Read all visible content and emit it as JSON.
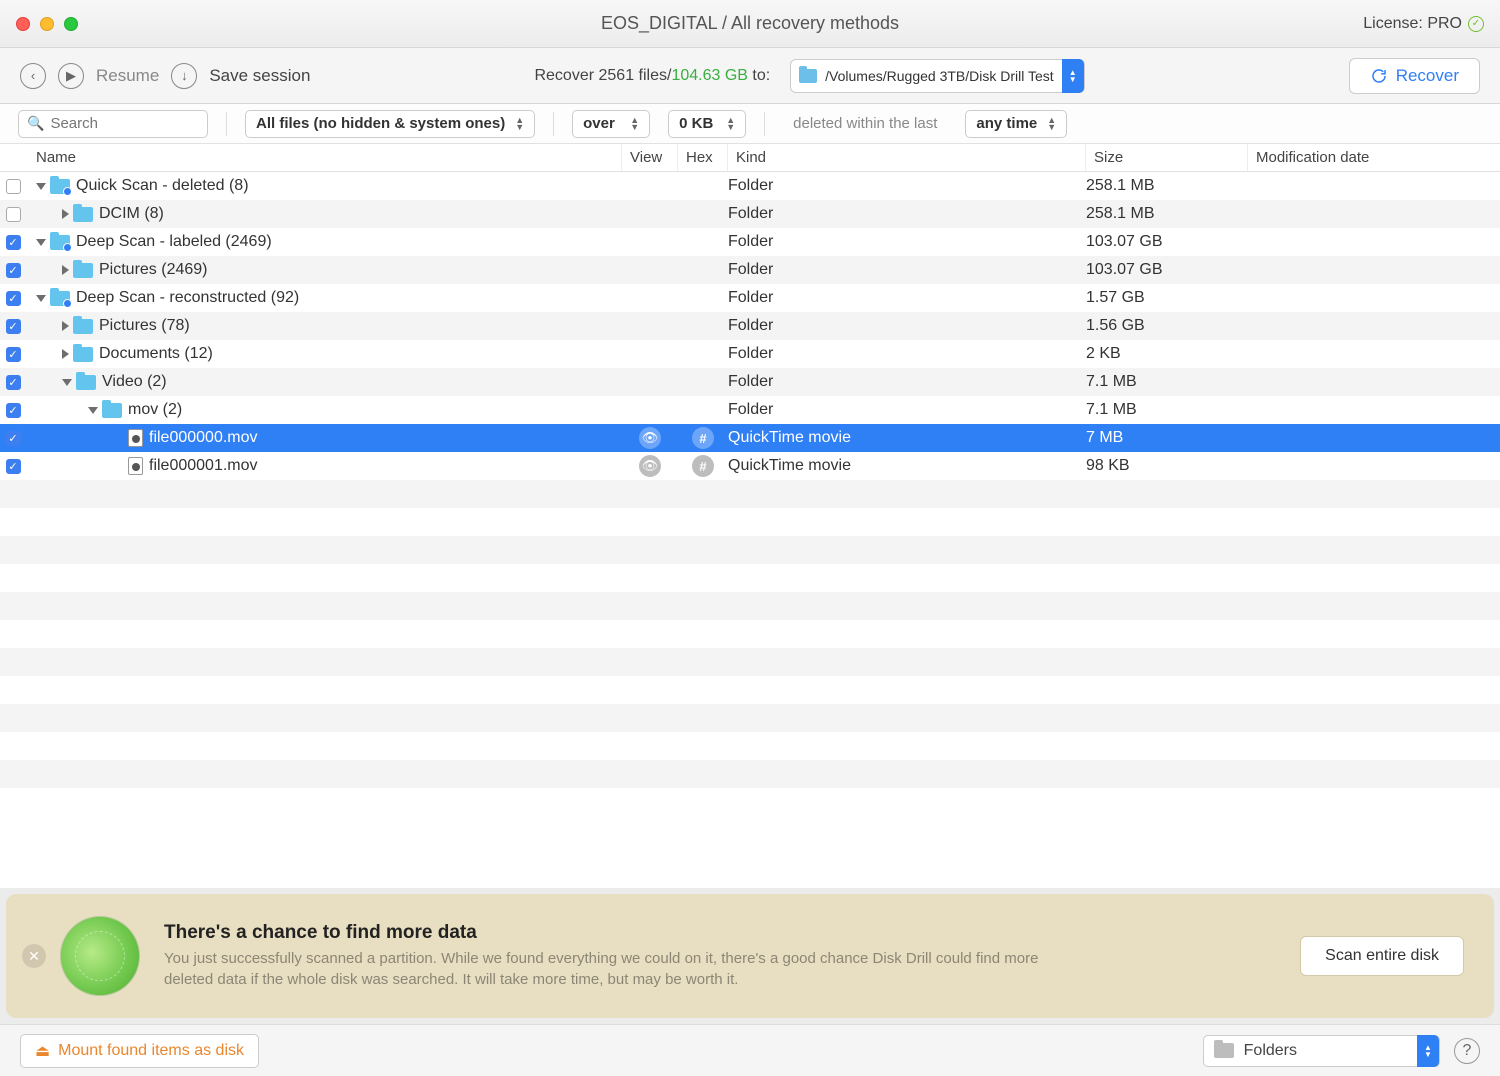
{
  "titlebar": {
    "title": "EOS_DIGITAL / All recovery methods",
    "license_label": "License: PRO"
  },
  "toolbar": {
    "resume_label": "Resume",
    "save_label": "Save session",
    "recover_prefix": "Recover ",
    "recover_files": "2561 files/",
    "recover_size": "104.63 GB",
    "recover_suffix": " to:",
    "path": "/Volumes/Rugged 3TB/Disk Drill Test",
    "recover_button": "Recover"
  },
  "filters": {
    "search_placeholder": "Search",
    "filter1": "All files (no hidden & system ones)",
    "filter2": "over",
    "filter3": "0 KB",
    "deleted_label": "deleted within the last",
    "timeframe": "any time"
  },
  "columns": {
    "name": "Name",
    "view": "View",
    "hex": "Hex",
    "kind": "Kind",
    "size": "Size",
    "mod": "Modification date"
  },
  "rows": [
    {
      "checked": false,
      "indent": 0,
      "arrow": "down",
      "icon": "folder-badge",
      "name": "Quick Scan - deleted (8)",
      "kind": "Folder",
      "size": "258.1 MB",
      "striped": false
    },
    {
      "checked": false,
      "indent": 1,
      "arrow": "right",
      "icon": "folder",
      "name": "DCIM (8)",
      "kind": "Folder",
      "size": "258.1 MB",
      "striped": true
    },
    {
      "checked": true,
      "indent": 0,
      "arrow": "down",
      "icon": "folder-badge",
      "name": "Deep Scan - labeled (2469)",
      "kind": "Folder",
      "size": "103.07 GB",
      "striped": false
    },
    {
      "checked": true,
      "indent": 1,
      "arrow": "right",
      "icon": "folder",
      "name": "Pictures (2469)",
      "kind": "Folder",
      "size": "103.07 GB",
      "striped": true
    },
    {
      "checked": true,
      "indent": 0,
      "arrow": "down",
      "icon": "folder-badge",
      "name": "Deep Scan - reconstructed (92)",
      "kind": "Folder",
      "size": "1.57 GB",
      "striped": false
    },
    {
      "checked": true,
      "indent": 1,
      "arrow": "right",
      "icon": "folder",
      "name": "Pictures (78)",
      "kind": "Folder",
      "size": "1.56 GB",
      "striped": true
    },
    {
      "checked": true,
      "indent": 1,
      "arrow": "right",
      "icon": "folder",
      "name": "Documents (12)",
      "kind": "Folder",
      "size": "2 KB",
      "striped": false
    },
    {
      "checked": true,
      "indent": 1,
      "arrow": "down",
      "icon": "folder",
      "name": "Video (2)",
      "kind": "Folder",
      "size": "7.1 MB",
      "striped": true
    },
    {
      "checked": true,
      "indent": 2,
      "arrow": "down",
      "icon": "folder",
      "name": "mov (2)",
      "kind": "Folder",
      "size": "7.1 MB",
      "striped": false
    },
    {
      "checked": true,
      "indent": 3,
      "arrow": "none",
      "icon": "file",
      "name": "file000000.mov",
      "kind": "QuickTime movie",
      "size": "7 MB",
      "striped": true,
      "selected": true,
      "preview": true
    },
    {
      "checked": true,
      "indent": 3,
      "arrow": "none",
      "icon": "file",
      "name": "file000001.mov",
      "kind": "QuickTime movie",
      "size": "98 KB",
      "striped": false,
      "preview": true
    }
  ],
  "banner": {
    "title": "There's a chance to find more data",
    "body": "You just successfully scanned a partition. While we found everything we could on it, there's a good chance Disk Drill could find more deleted data if the whole disk was searched. It will take more time, but may be worth it.",
    "button": "Scan entire disk"
  },
  "footer": {
    "mount_label": "Mount found items as disk",
    "view_mode": "Folders"
  }
}
